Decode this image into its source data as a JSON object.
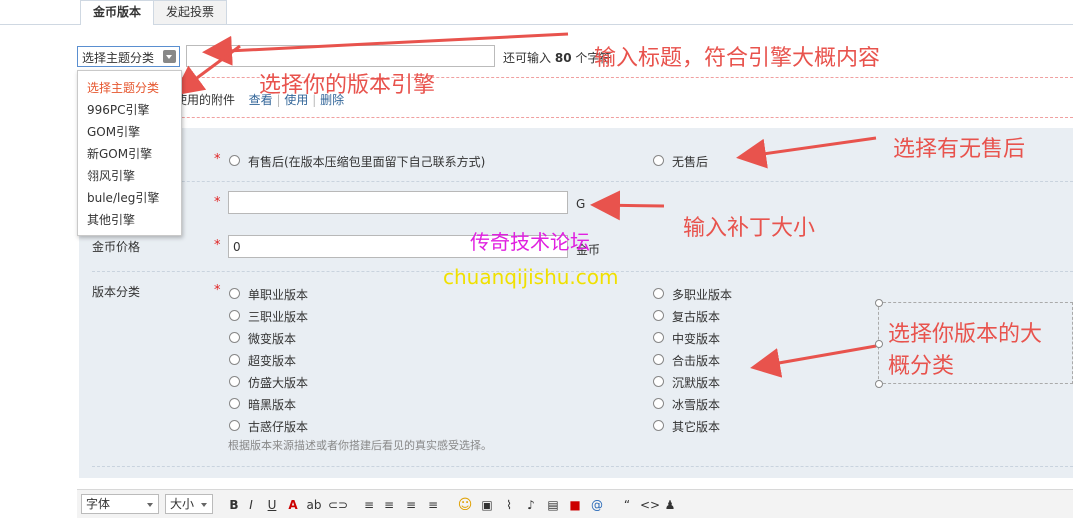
{
  "tabs": [
    "金币版本",
    "发起投票"
  ],
  "subject": {
    "select_value": "选择主题分类",
    "hint_prefix": "还可输入",
    "hint_count": "80",
    "hint_suffix": "个字符"
  },
  "attachments": {
    "text": "使用的附件",
    "view": "查看",
    "use": "使用",
    "delete": "删除"
  },
  "dropdown_options": [
    "选择主题分类",
    "996PC引擎",
    "GOM引擎",
    "新GOM引擎",
    "翎风引擎",
    "bule/leg引擎",
    "其他引擎"
  ],
  "after_sales": {
    "star": "*",
    "option_yes": "有售后(在版本压缩包里面留下自己联系方式)",
    "option_no": "无售后"
  },
  "patch_size": {
    "star": "*",
    "unit": "G"
  },
  "price": {
    "label": "金币价格",
    "star": "*",
    "value": "0",
    "unit": "金币"
  },
  "category": {
    "label": "版本分类",
    "star": "*",
    "left": [
      "单职业版本",
      "三职业版本",
      "微变版本",
      "超变版本",
      "仿盛大版本",
      "暗黑版本",
      "古惑仔版本"
    ],
    "right": [
      "多职业版本",
      "复古版本",
      "中变版本",
      "合击版本",
      "沉默版本",
      "冰雪版本",
      "其它版本"
    ],
    "note": "根据版本来源描述或者你搭建后看见的真实感受选择。"
  },
  "toolbar": {
    "font_label": "字体",
    "size_label": "大小",
    "icons": [
      "bold-icon",
      "italic-icon",
      "underline-icon",
      "font-color-icon",
      "highlight-icon",
      "link-icon",
      "align-left-icon",
      "align-center-icon",
      "align-justify-icon",
      "align-right-icon",
      "emoji-icon",
      "image-icon",
      "attachment-icon",
      "music-icon",
      "video-icon",
      "flash-icon",
      "email-icon",
      "quote-icon",
      "code-icon",
      "qq-icon"
    ]
  },
  "annotations": {
    "title": "输入标题，符合引擎大概内容",
    "engine": "选择你的版本引擎",
    "after_sales": "选择有无售后",
    "patch": "输入补丁大小",
    "category_line1": "选择你版本的大",
    "category_line2": "概分类"
  },
  "watermark": {
    "cn": "传奇技术论坛",
    "en": "chuanqijishu.com"
  },
  "colors": {
    "annotation": "#e8534d",
    "watermark_cn": "#e020e0",
    "watermark_en": "#f0e000",
    "required": "#e02020",
    "selected_option": "#e6562e",
    "link": "#336699",
    "panel_bg": "#e9eef3"
  }
}
